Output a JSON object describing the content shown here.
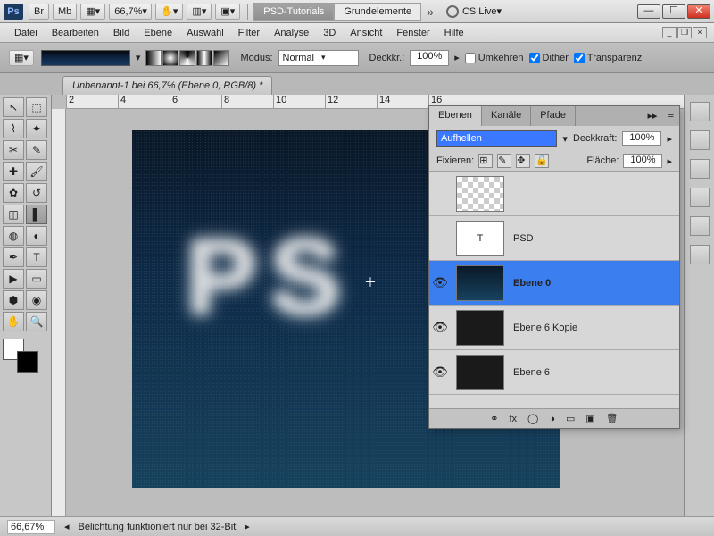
{
  "titlebar": {
    "zoom": "66,7%",
    "tab_active": "PSD-Tutorials",
    "tab_inactive": "Grundelemente",
    "cslive": "CS Live"
  },
  "menu": {
    "datei": "Datei",
    "bearbeiten": "Bearbeiten",
    "bild": "Bild",
    "ebene": "Ebene",
    "auswahl": "Auswahl",
    "filter": "Filter",
    "analyse": "Analyse",
    "dreid": "3D",
    "ansicht": "Ansicht",
    "fenster": "Fenster",
    "hilfe": "Hilfe"
  },
  "options": {
    "modus_label": "Modus:",
    "modus_value": "Normal",
    "deck_label": "Deckkr.:",
    "deck_value": "100%",
    "umkehren": "Umkehren",
    "dither": "Dither",
    "transparenz": "Transparenz"
  },
  "doc_tab": "Unbenannt-1 bei 66,7% (Ebene 0, RGB/8) *",
  "ruler_marks": [
    "2",
    "4",
    "6",
    "8",
    "10",
    "12",
    "14",
    "16"
  ],
  "canvas_text": "PS",
  "panel": {
    "tabs": {
      "ebenen": "Ebenen",
      "kanaele": "Kanäle",
      "pfade": "Pfade"
    },
    "blend": "Aufhellen",
    "deck_label": "Deckkraft:",
    "deck_value": "100%",
    "fix_label": "Fixieren:",
    "fill_label": "Fläche:",
    "fill_value": "100%",
    "layers": [
      {
        "name": "",
        "thumb": "check",
        "vis": false
      },
      {
        "name": "PSD",
        "thumb": "white",
        "vis": false,
        "glyph": "T"
      },
      {
        "name": "Ebene 0",
        "thumb": "dark",
        "vis": true,
        "active": true
      },
      {
        "name": "Ebene 6 Kopie",
        "thumb": "noise",
        "vis": true
      },
      {
        "name": "Ebene 6",
        "thumb": "noise",
        "vis": true
      }
    ],
    "footer_fx": "fx"
  },
  "status": {
    "zoom": "66,67%",
    "msg": "Belichtung funktioniert nur bei 32-Bit"
  }
}
